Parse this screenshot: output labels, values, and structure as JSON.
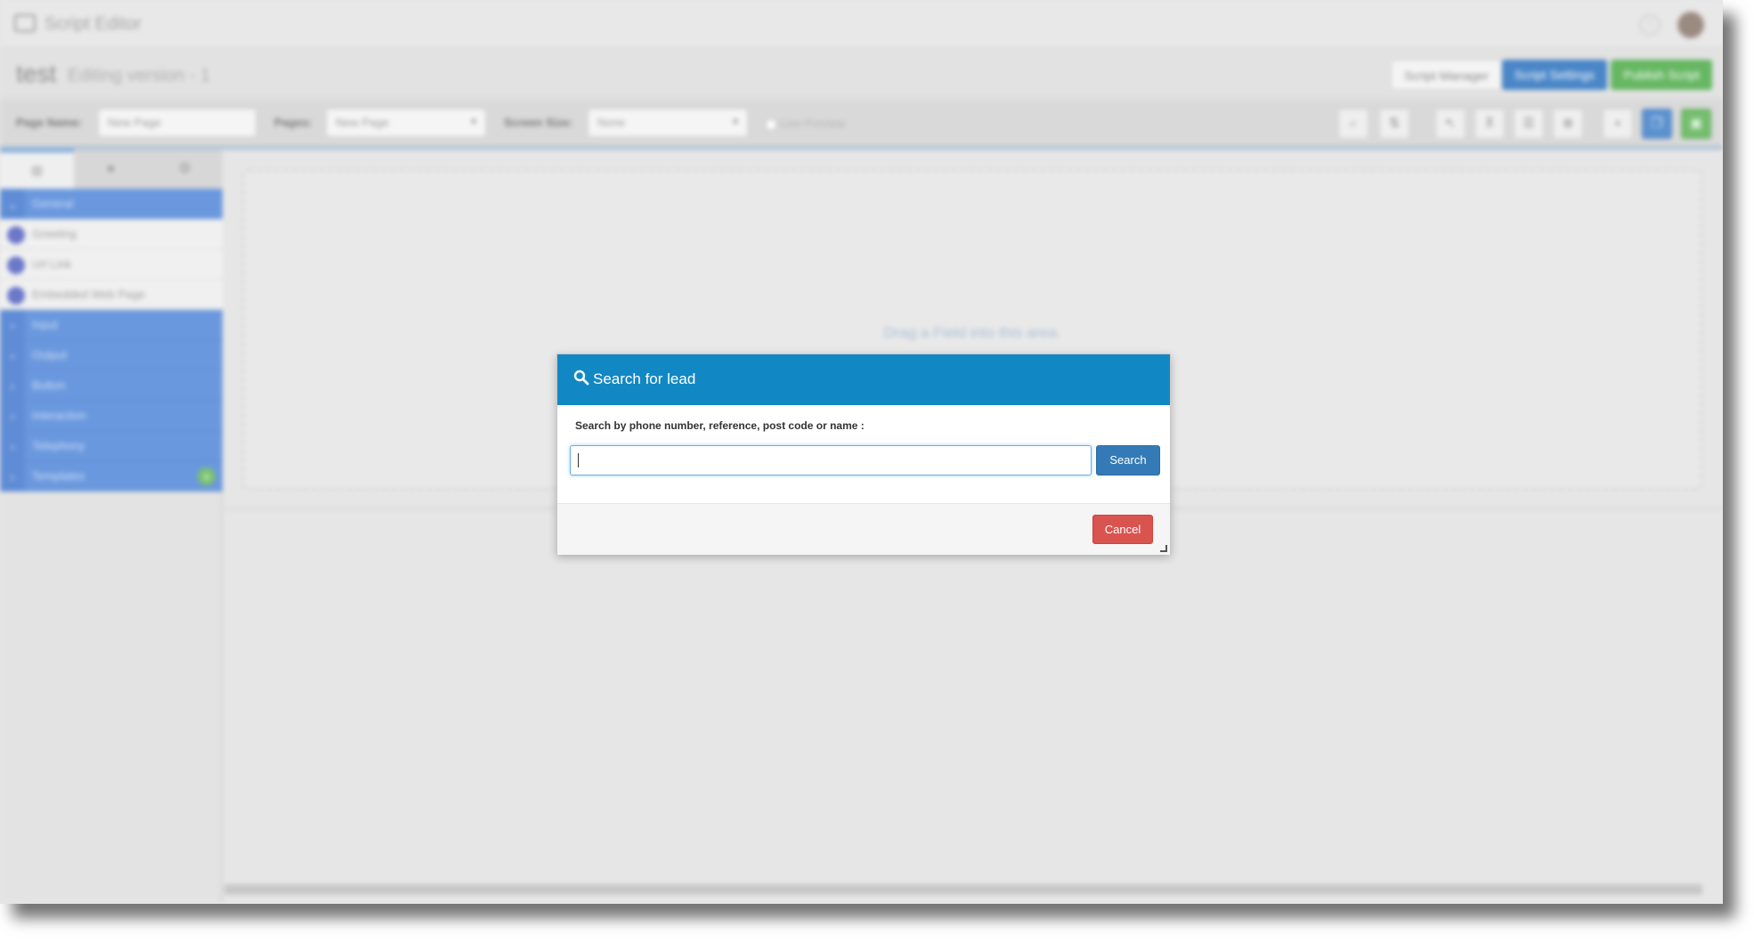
{
  "titlebar": {
    "app_title": "Script Editor",
    "help_glyph": "?"
  },
  "heading": {
    "script_name": "test",
    "version_label": "Editing version - 1",
    "buttons": {
      "manager": "Script Manager",
      "settings": "Script Settings",
      "publish": "Publish Script"
    }
  },
  "toolbar": {
    "page_name_label": "Page Name:",
    "page_name_value": "New Page",
    "pages_label": "Pages:",
    "pages_value": "New Page",
    "screen_size_label": "Screen Size:",
    "screen_size_value": "None",
    "live_preview_label": "Live Preview",
    "icons": [
      "search-icon",
      "chart-icon",
      "pointer-icon",
      "sitemap-icon",
      "list-icon",
      "crosshair-icon",
      "file-icon",
      "copy-icon",
      "save-icon"
    ]
  },
  "sidebar": {
    "tabs": [
      "grid-icon",
      "circle-icon",
      "settings-icon"
    ],
    "categories": [
      {
        "label": "General",
        "expanded": true,
        "items": [
          "Greeting",
          "Url Link",
          "Embedded Web Page"
        ]
      },
      {
        "label": "Input"
      },
      {
        "label": "Output"
      },
      {
        "label": "Button"
      },
      {
        "label": "Interaction"
      },
      {
        "label": "Telephony"
      },
      {
        "label": "Templates"
      }
    ]
  },
  "canvas": {
    "drop_hint": "Drag a Field into this area."
  },
  "modal": {
    "title": "Search for lead",
    "prompt": "Search by phone number, reference, post code or name :",
    "input_value": "",
    "search_label": "Search",
    "cancel_label": "Cancel"
  },
  "colors": {
    "modal_header": "#1188c4",
    "search_button": "#337ab7",
    "cancel_button": "#d9534f",
    "sidebar_category": "#6a98de",
    "publish_button": "#66b762",
    "settings_button": "#4a86c8"
  }
}
